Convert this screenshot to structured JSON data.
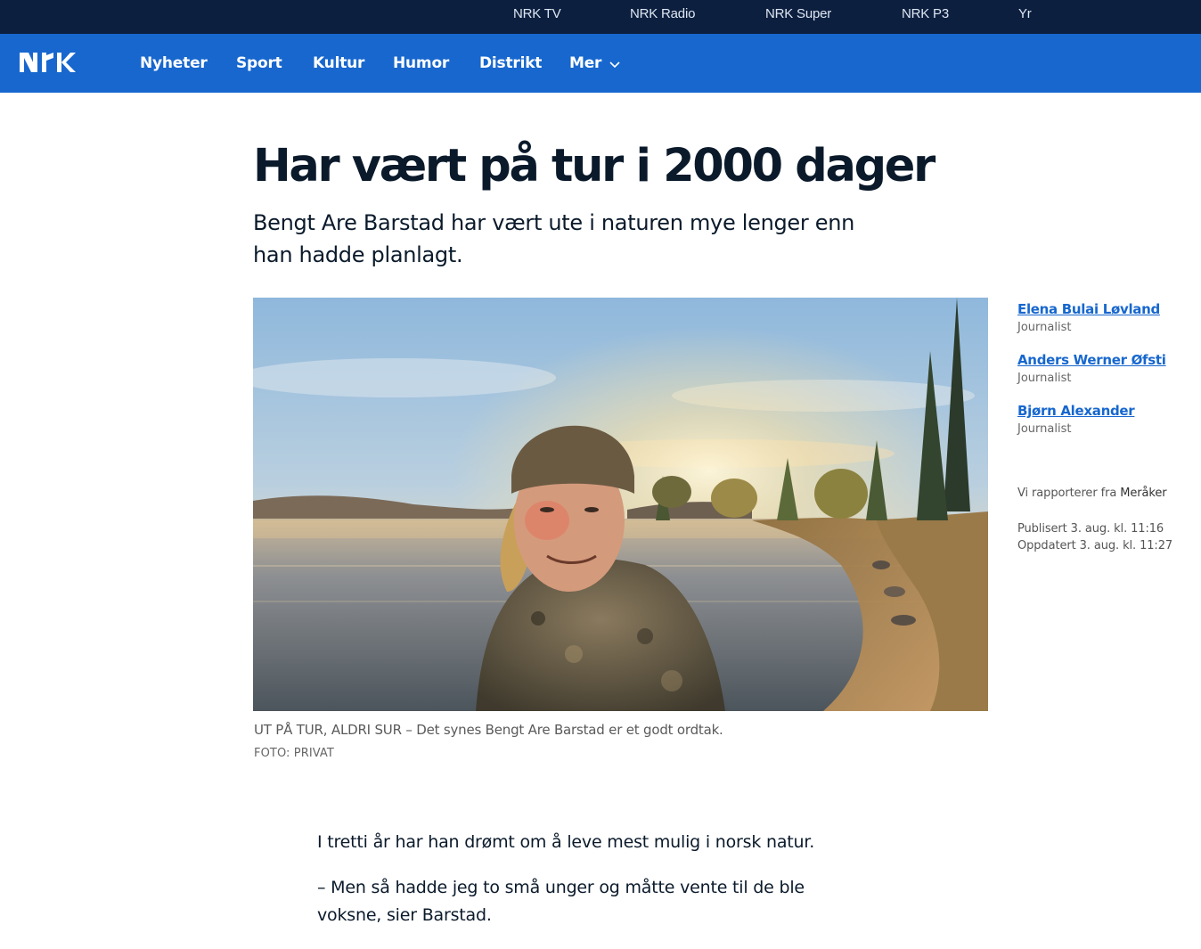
{
  "top_links": [
    "NRK TV",
    "NRK Radio",
    "NRK Super",
    "NRK P3",
    "Yr"
  ],
  "nav": {
    "logo": "NRK",
    "items": [
      "Nyheter",
      "Sport",
      "Kultur",
      "Humor",
      "Distrikt",
      "Mer"
    ]
  },
  "article": {
    "title": "Har vært på tur i 2000 dager",
    "lead": "Bengt Are Barstad har vært ute i naturen mye lenger enn han hadde planlagt.",
    "image": {
      "caption": "UT PÅ TUR, ALDRI SUR – Det synes Bengt Are Barstad er et godt ordtak.",
      "credit": "FOTO: PRIVAT"
    },
    "paragraphs": [
      "I tretti år har han drømt om å leve mest mulig i norsk natur.",
      "– Men så hadde jeg to små unger og måtte vente til de ble voksne, sier Barstad."
    ]
  },
  "sidebar": {
    "authors": [
      {
        "name": "Elena Bulai Løvland",
        "role": "Journalist"
      },
      {
        "name": "Anders Werner Øfsti",
        "role": "Journalist"
      },
      {
        "name": "Bjørn Alexander",
        "role": "Journalist"
      }
    ],
    "reporting_label": "Vi rapporterer fra",
    "reporting_place": "Meråker",
    "published": "Publisert 3. aug. kl. 11:16",
    "updated": "Oppdatert 3. aug. kl. 11:27"
  },
  "colors": {
    "top_bar": "#0c1f3f",
    "nav_bar": "#1767ce",
    "link": "#1767ce",
    "text": "#0b1a2b"
  },
  "icons": {
    "logo": "nrk-logo",
    "more": "chevron-down-icon"
  }
}
